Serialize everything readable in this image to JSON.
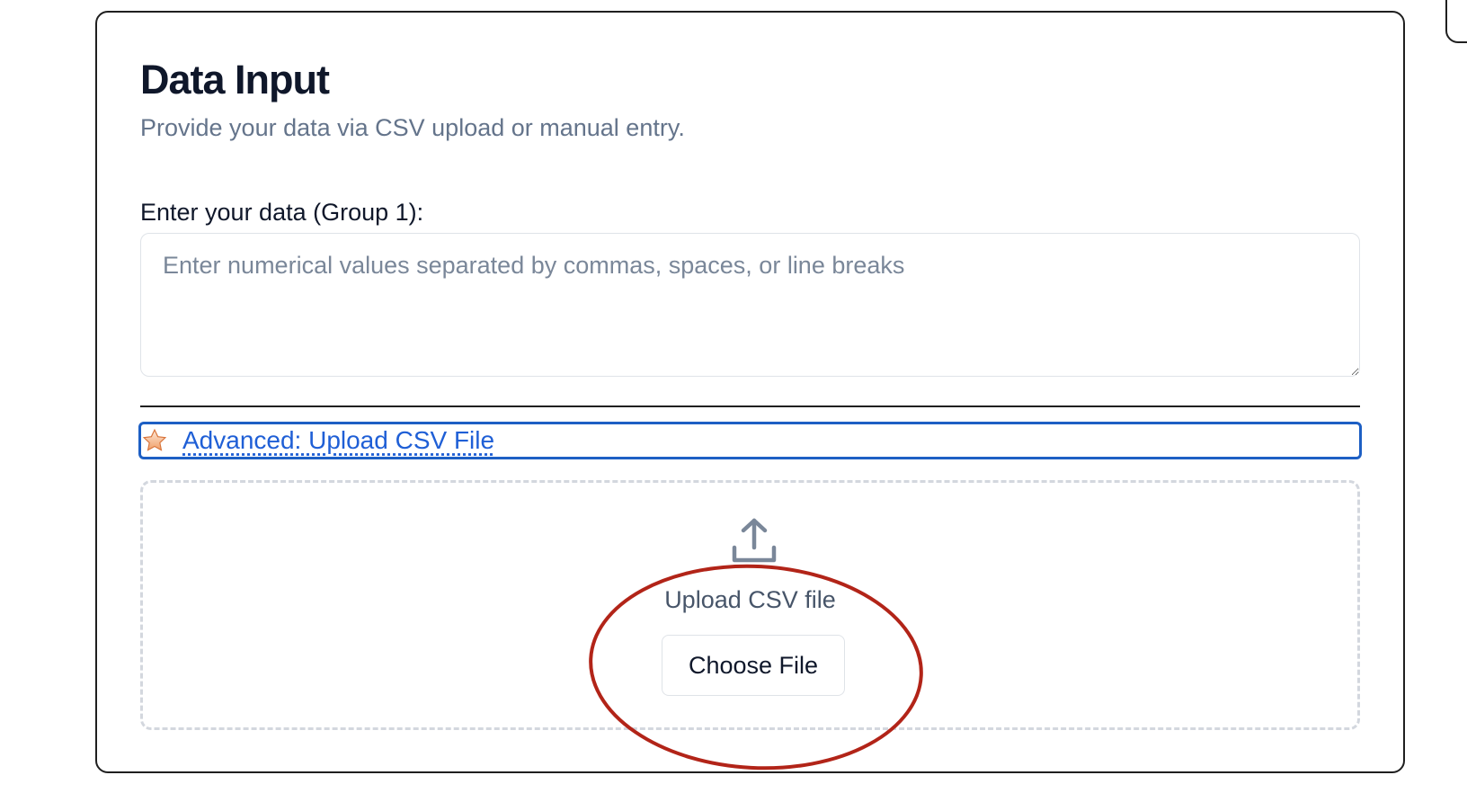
{
  "card": {
    "title": "Data Input",
    "subtitle": "Provide your data via CSV upload or manual entry."
  },
  "manual_entry": {
    "label": "Enter your data (Group 1):",
    "value": "",
    "placeholder": "Enter numerical values separated by commas, spaces, or line breaks"
  },
  "advanced": {
    "icon": "star-icon",
    "label": "Advanced: Upload CSV File",
    "focused": true,
    "focus_color": "#1d5fc4"
  },
  "upload": {
    "icon": "upload-icon",
    "text": "Upload CSV file",
    "button_label": "Choose File"
  },
  "annotation": {
    "shape": "ellipse",
    "color": "#b22418",
    "target": "choose-file-button"
  },
  "colors": {
    "link": "#1f5fd6",
    "title": "#0f172a",
    "muted": "#64748b"
  }
}
